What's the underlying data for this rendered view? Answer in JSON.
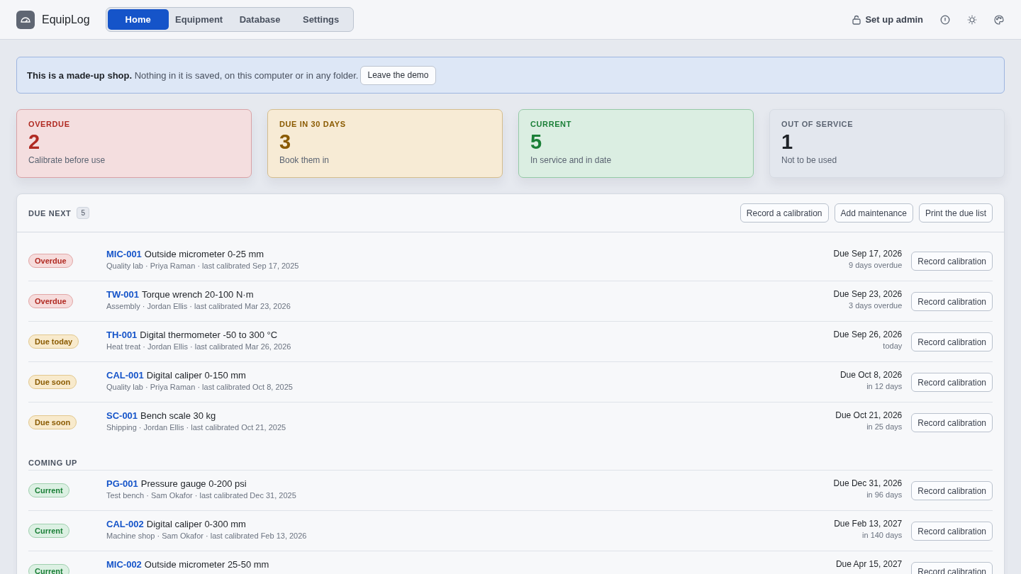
{
  "app": {
    "name": "EquipLog"
  },
  "tabs": [
    {
      "label": "Home",
      "selected": true
    },
    {
      "label": "Equipment",
      "selected": false
    },
    {
      "label": "Database",
      "selected": false
    },
    {
      "label": "Settings",
      "selected": false
    }
  ],
  "header_actions": {
    "admin": "Set up admin"
  },
  "banner": {
    "text": "**This is a made-up shop.** Nothing in it is saved, on this computer or in any folder.",
    "button": "Leave the demo"
  },
  "stats": [
    {
      "kind": "overdue",
      "label": "OVERDUE",
      "value": "2",
      "note": "Calibrate before use"
    },
    {
      "kind": "due",
      "label": "DUE IN 30 DAYS",
      "value": "3",
      "note": "Book them in"
    },
    {
      "kind": "current",
      "label": "CURRENT",
      "value": "5",
      "note": "In service and in date"
    },
    {
      "kind": "out",
      "label": "OUT OF SERVICE",
      "value": "1",
      "note": "Not to be used"
    }
  ],
  "panel": {
    "title": "DUE NEXT",
    "count": "5",
    "actions": [
      "Record a calibration",
      "Add maintenance",
      "Print the due list"
    ],
    "groups": [
      {
        "rows": [
          {
            "kind": "overdue",
            "badge": "Overdue",
            "code": "MIC-001",
            "name": "Outside micrometer 0-25 mm",
            "meta": "Quality lab · Priya Raman · last calibrated Sep 17, 2025",
            "due": "Due Sep 17, 2026",
            "relative": "9 days overdue",
            "button": "Record calibration"
          },
          {
            "kind": "overdue",
            "badge": "Overdue",
            "code": "TW-001",
            "name": "Torque wrench 20-100 N·m",
            "meta": "Assembly · Jordan Ellis · last calibrated Mar 23, 2026",
            "due": "Due Sep 23, 2026",
            "relative": "3 days overdue",
            "button": "Record calibration"
          },
          {
            "kind": "soon",
            "badge": "Due today",
            "code": "TH-001",
            "name": "Digital thermometer -50 to 300 °C",
            "meta": "Heat treat · Jordan Ellis · last calibrated Mar 26, 2026",
            "due": "Due Sep 26, 2026",
            "relative": "today",
            "button": "Record calibration"
          },
          {
            "kind": "soon",
            "badge": "Due soon",
            "code": "CAL-001",
            "name": "Digital caliper 0-150 mm",
            "meta": "Quality lab · Priya Raman · last calibrated Oct 8, 2025",
            "due": "Due Oct 8, 2026",
            "relative": "in 12 days",
            "button": "Record calibration"
          },
          {
            "kind": "soon",
            "badge": "Due soon",
            "code": "SC-001",
            "name": "Bench scale 30 kg",
            "meta": "Shipping · Jordan Ellis · last calibrated Oct 21, 2025",
            "due": "Due Oct 21, 2026",
            "relative": "in 25 days",
            "button": "Record calibration"
          }
        ]
      },
      {
        "heading": "COMING UP",
        "rows": [
          {
            "kind": "current",
            "badge": "Current",
            "code": "PG-001",
            "name": "Pressure gauge 0-200 psi",
            "meta": "Test bench · Sam Okafor · last calibrated Dec 31, 2025",
            "due": "Due Dec 31, 2026",
            "relative": "in 96 days",
            "button": "Record calibration"
          },
          {
            "kind": "current",
            "badge": "Current",
            "code": "CAL-002",
            "name": "Digital caliper 0-300 mm",
            "meta": "Machine shop · Sam Okafor · last calibrated Feb 13, 2026",
            "due": "Due Feb 13, 2027",
            "relative": "in 140 days",
            "button": "Record calibration"
          },
          {
            "kind": "current",
            "badge": "Current",
            "code": "MIC-002",
            "name": "Outside micrometer 25-50 mm",
            "due": "Due Apr 15, 2027",
            "button": "Record calibration"
          }
        ]
      }
    ]
  }
}
